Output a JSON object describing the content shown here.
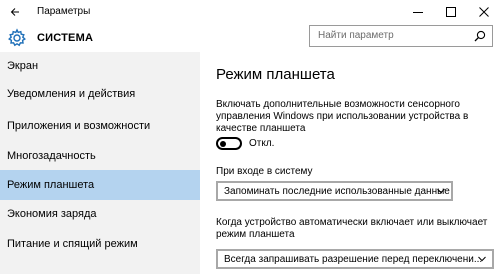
{
  "window": {
    "title": "Параметры",
    "back_icon": "back-arrow-icon",
    "minimize_icon": "minimize-icon",
    "maximize_icon": "maximize-icon",
    "close_icon": "close-icon"
  },
  "app": {
    "section_name": "СИСТЕМА",
    "section_icon": "gear-icon"
  },
  "search": {
    "placeholder": "Найти параметр",
    "icon": "search-icon"
  },
  "sidebar": {
    "items": [
      {
        "label": "Экран",
        "active": false
      },
      {
        "label": "Уведомления и действия",
        "active": false
      },
      {
        "label": "Приложения и возможности",
        "active": false
      },
      {
        "label": "Многозадачность",
        "active": false
      },
      {
        "label": "Режим планшета",
        "active": true
      },
      {
        "label": "Экономия заряда",
        "active": false
      },
      {
        "label": "Питание и спящий режим",
        "active": false
      }
    ]
  },
  "main": {
    "heading": "Режим планшета",
    "touch_description": "Включать дополнительные возможности сенсорного управления Windows при использовании устройства в качестве планшета",
    "toggle_state": "Откл.",
    "signin_label": "При входе в систему",
    "signin_value": "Запоминать последние использованные данные",
    "auto_description": "Когда устройство автоматически включает или выключает режим планшета",
    "auto_value": "Всегда запрашивать разрешение перед переключени..."
  },
  "colors": {
    "active_item": "#b4d3ef",
    "sidebar_bg": "#f2f2f2",
    "accent": "#1e6fb8"
  }
}
